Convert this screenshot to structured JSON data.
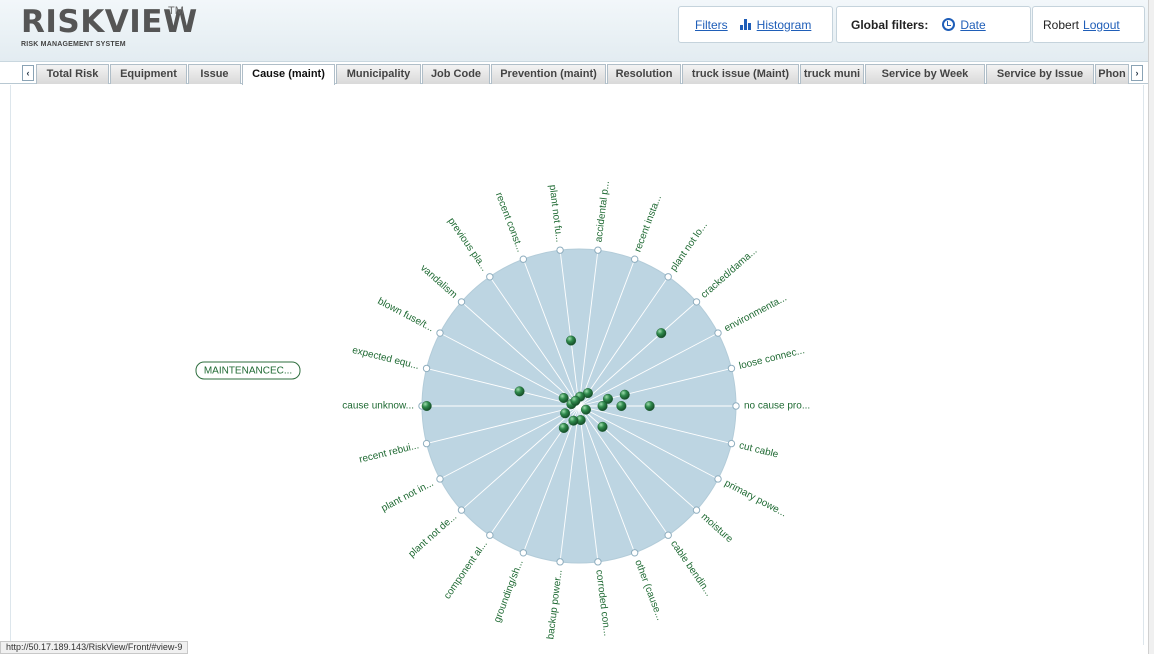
{
  "app": {
    "logo": "RISKVIEW",
    "logo_tm": "TM",
    "subtitle": "RISK MANAGEMENT SYSTEM"
  },
  "header": {
    "filters_label": "Filters",
    "histogram_label": "Histogram",
    "global_filters_label": "Global filters:",
    "date_label": "Date",
    "user_name": "Robert",
    "logout_label": "Logout"
  },
  "tabs": [
    {
      "label": "Total Risk"
    },
    {
      "label": "Equipment"
    },
    {
      "label": "Issue"
    },
    {
      "label": "Cause (maint)",
      "active": true
    },
    {
      "label": "Municipality"
    },
    {
      "label": "Job Code"
    },
    {
      "label": "Prevention (maint)"
    },
    {
      "label": "Resolution"
    },
    {
      "label": "truck issue (Maint)"
    },
    {
      "label": "truck muni"
    },
    {
      "label": "Service by Week"
    },
    {
      "label": "Service by Issue"
    },
    {
      "label": "Phon"
    }
  ],
  "chart": {
    "center_button_label": "MAINTENANCEC...",
    "spokes": [
      "no cause pro...",
      "cut cable",
      "primary powe...",
      "moisture",
      "cable bendin...",
      "other (cause...",
      "corroded con...",
      "backup power...",
      "grounding/sh...",
      "component al...",
      "plant not de...",
      "plant not in...",
      "recent rebui...",
      "cause unknow...",
      "expected equ...",
      "blown fuse/t...",
      "vandalism",
      "previous pla...",
      "recent const...",
      "plant not fu...",
      "accidental p...",
      "recent insta...",
      "plant not lo...",
      "cracked/dama...",
      "environmenta...",
      "loose connec..."
    ],
    "data_points": [
      {
        "r": 0.97,
        "spoke": 13
      },
      {
        "r": 0.7,
        "spoke": 23
      },
      {
        "r": 0.42,
        "spoke": 19
      },
      {
        "r": 0.39,
        "spoke": 14
      },
      {
        "r": 0.45,
        "spoke": 0
      },
      {
        "r": 0.3,
        "spoke": 25
      },
      {
        "r": 0.27,
        "spoke": 0
      },
      {
        "r": 0.19,
        "spoke": 25
      },
      {
        "r": 0.15,
        "spoke": 0
      },
      {
        "r": 0.2,
        "spoke": 3
      },
      {
        "r": 0.17,
        "spoke": 9
      },
      {
        "r": 0.1,
        "spoke": 22
      },
      {
        "r": 0.06,
        "spoke": 20
      },
      {
        "r": 0.05,
        "spoke": 2
      },
      {
        "r": 0.1,
        "spoke": 11
      },
      {
        "r": 0.05,
        "spoke": 14
      },
      {
        "r": 0.09,
        "spoke": 6
      },
      {
        "r": 0.11,
        "spoke": 15
      },
      {
        "r": 0.04,
        "spoke": 17
      },
      {
        "r": 0.1,
        "spoke": 8
      }
    ]
  },
  "status_url": "http://50.17.189.143/RiskView/Front/#view-9"
}
